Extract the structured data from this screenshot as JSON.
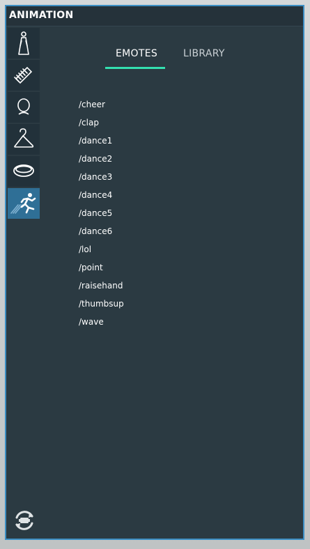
{
  "window": {
    "title": "ANIMATION"
  },
  "sidebar": {
    "items": [
      {
        "icon": "person-icon",
        "active": false
      },
      {
        "icon": "comb-icon",
        "active": false
      },
      {
        "icon": "head-icon",
        "active": false
      },
      {
        "icon": "hanger-icon",
        "active": false
      },
      {
        "icon": "ring-icon",
        "active": false
      },
      {
        "icon": "running-icon",
        "active": true
      }
    ]
  },
  "tabs": [
    {
      "label": "EMOTES",
      "active": true
    },
    {
      "label": "LIBRARY",
      "active": false
    }
  ],
  "emotes": [
    "/cheer",
    "/clap",
    "/dance1",
    "/dance2",
    "/dance3",
    "/dance4",
    "/dance5",
    "/dance6",
    "/lol",
    "/point",
    "/raisehand",
    "/thumbsup",
    "/wave"
  ],
  "footer": {
    "reset_icon": "reset-avatar-icon"
  },
  "colors": {
    "panel_bg": "#2b3a42",
    "border": "#3d8fc4",
    "active_sidebar": "#2f6f96",
    "tab_underline": "#34e0b0"
  }
}
